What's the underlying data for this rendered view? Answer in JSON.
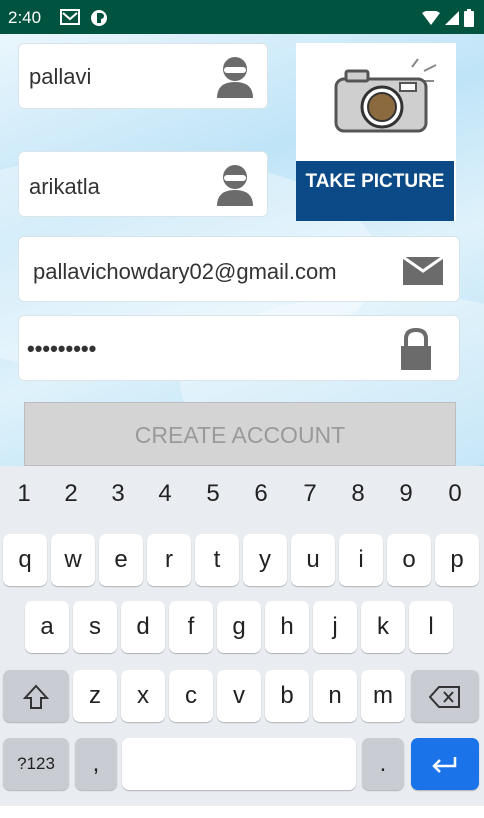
{
  "status_bar": {
    "time": "2:40"
  },
  "form": {
    "first_name": "pallavi",
    "last_name": "arikatla",
    "email": "pallavichowdary02@gmail.com",
    "password": "•••••••••",
    "take_picture_label": "TAKE PICTURE",
    "create_account_label": "CREATE ACCOUNT"
  },
  "keyboard": {
    "numbers": [
      "1",
      "2",
      "3",
      "4",
      "5",
      "6",
      "7",
      "8",
      "9",
      "0"
    ],
    "row1": [
      "q",
      "w",
      "e",
      "r",
      "t",
      "y",
      "u",
      "i",
      "o",
      "p"
    ],
    "row2": [
      "a",
      "s",
      "d",
      "f",
      "g",
      "h",
      "j",
      "k",
      "l"
    ],
    "row3": [
      "z",
      "x",
      "c",
      "v",
      "b",
      "n",
      "m"
    ],
    "symbols_label": "?123",
    "comma_label": ",",
    "period_label": "."
  }
}
